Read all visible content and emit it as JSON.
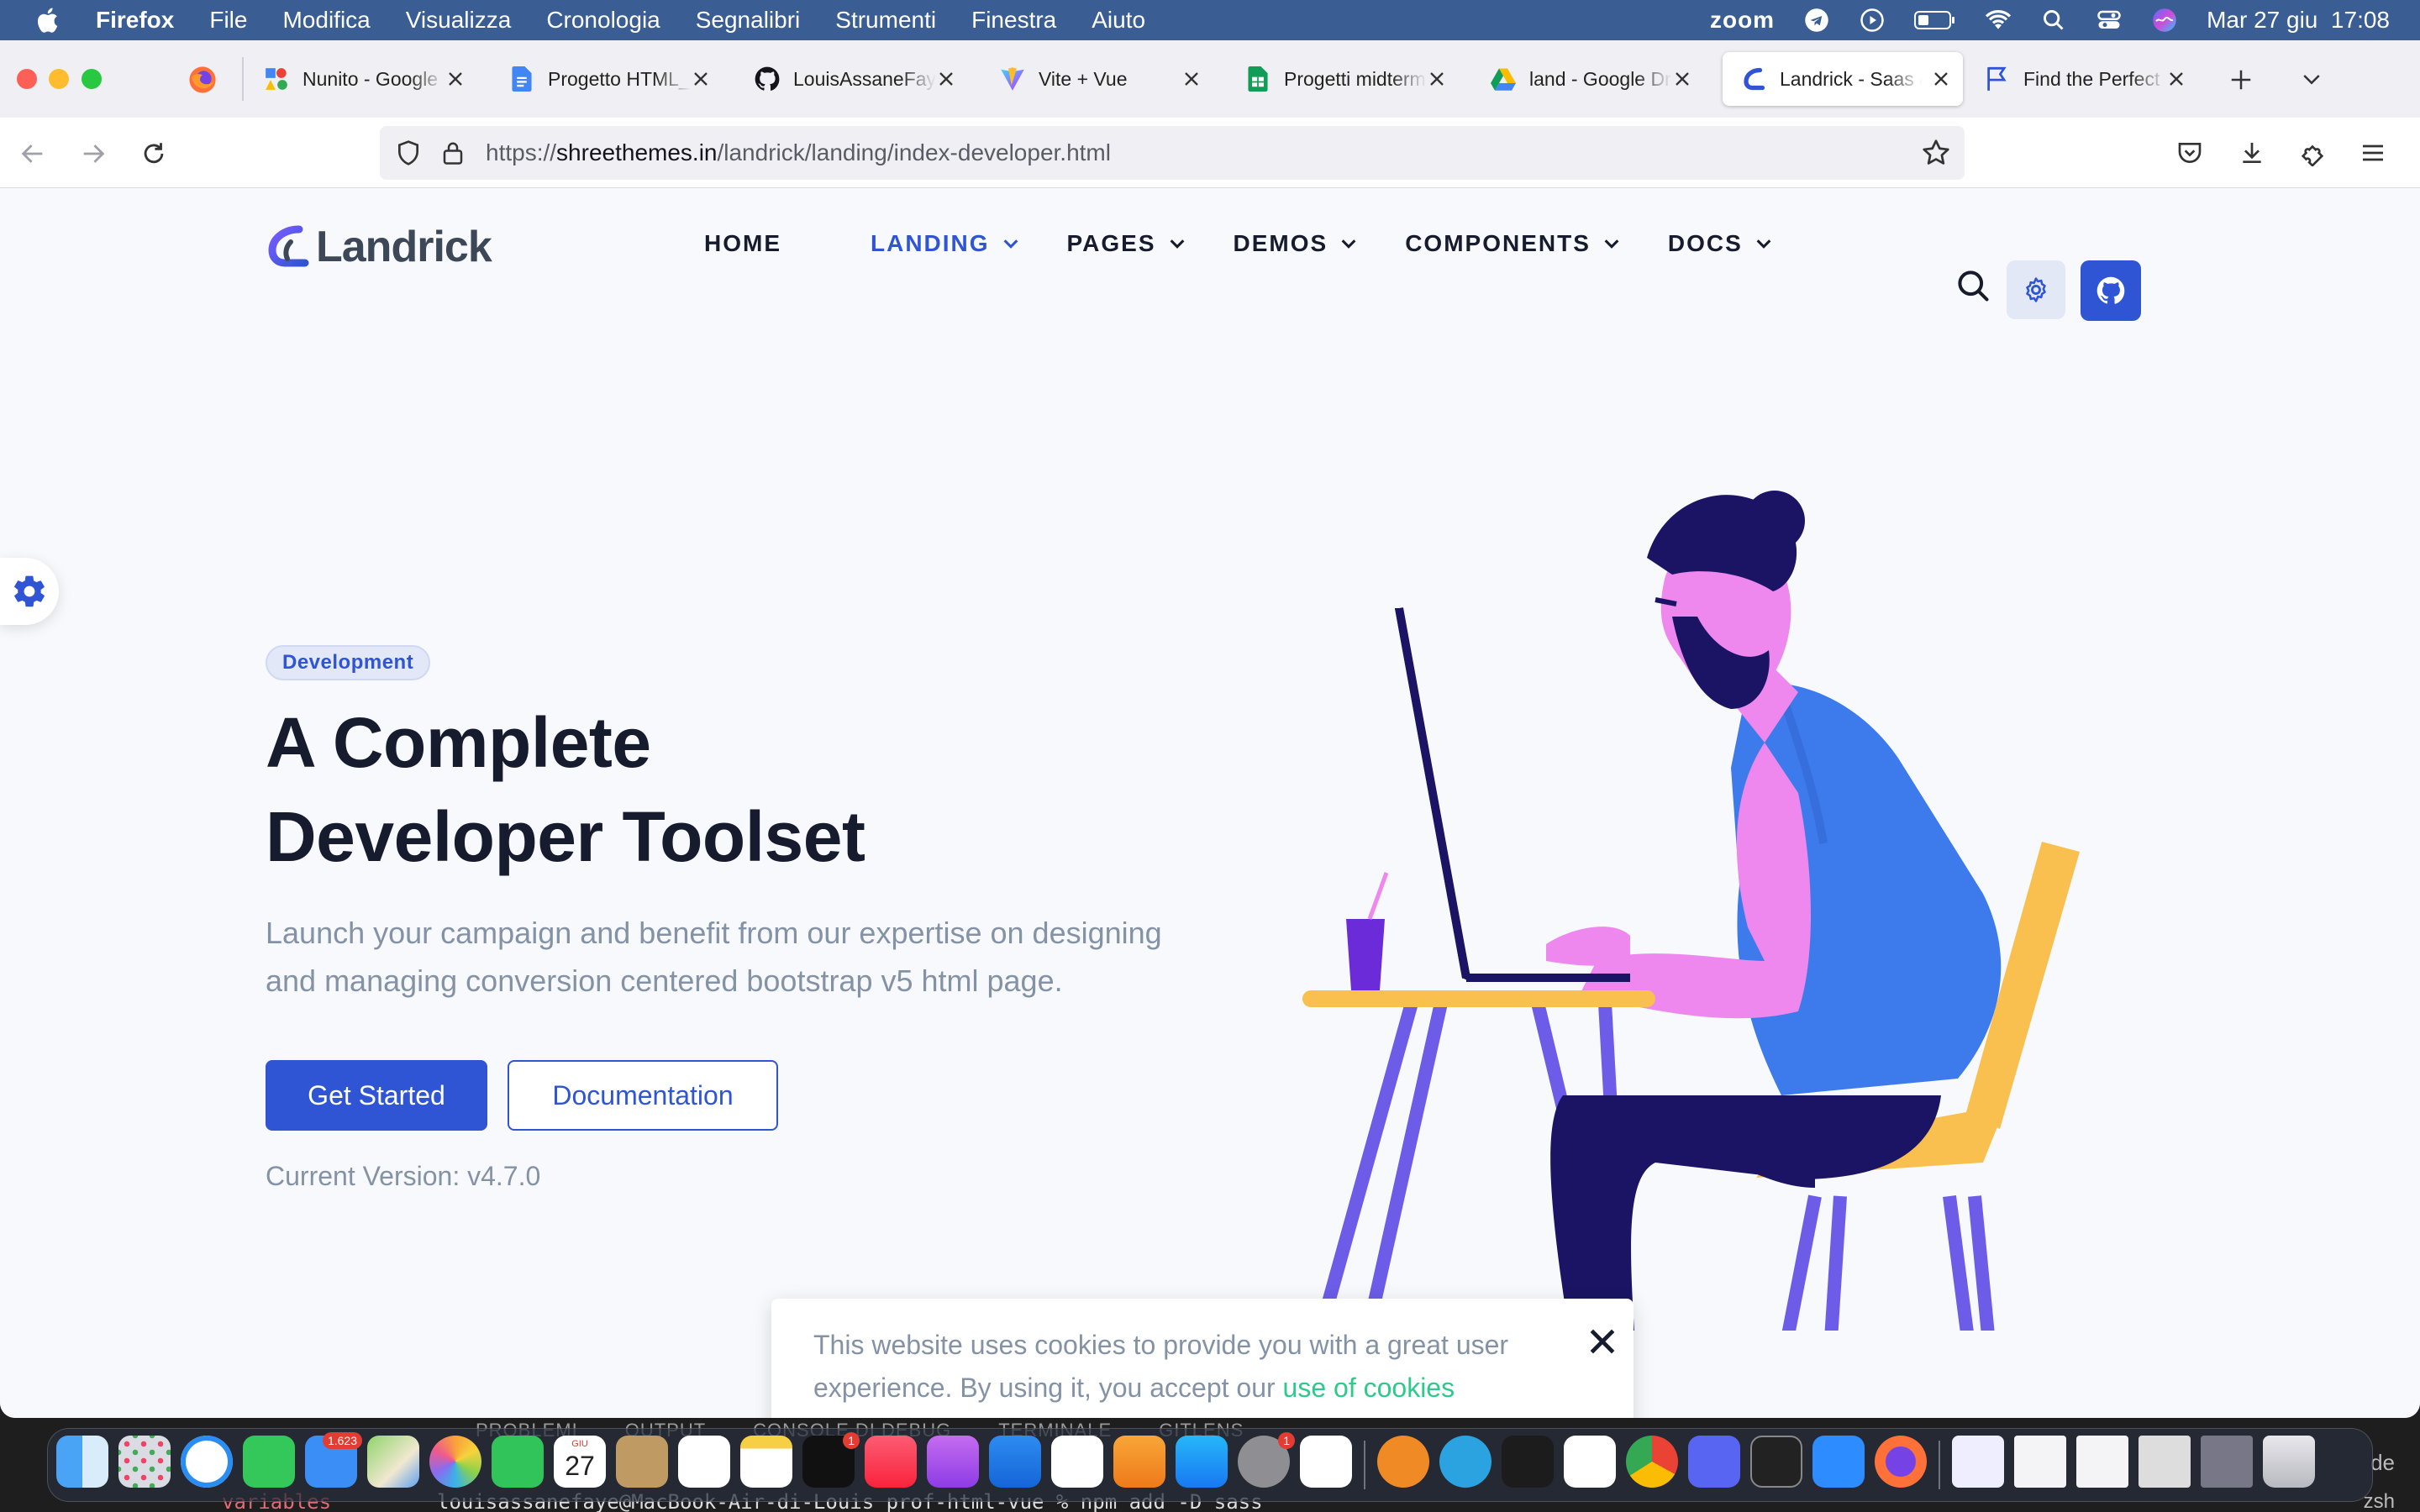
{
  "menubar": {
    "items": [
      "Firefox",
      "File",
      "Modifica",
      "Visualizza",
      "Cronologia",
      "Segnalibri",
      "Strumenti",
      "Finestra",
      "Aiuto"
    ],
    "zoom_label": "zoom",
    "clock": "Mar 27 giu  17:08"
  },
  "tabs": [
    {
      "title": "Nunito - Google F",
      "icon": "google-fonts-icon"
    },
    {
      "title": "Progetto HTML_V",
      "icon": "google-docs-icon"
    },
    {
      "title": "LouisAssaneFaye",
      "icon": "github-icon"
    },
    {
      "title": "Vite + Vue",
      "icon": "vite-icon"
    },
    {
      "title": "Progetti midterm",
      "icon": "google-sheets-icon"
    },
    {
      "title": "land - Google Dri",
      "icon": "google-drive-icon"
    },
    {
      "title": "Landrick - Saas &",
      "icon": "landrick-icon",
      "active": true
    },
    {
      "title": "Find the Perfect",
      "icon": "flag-icon"
    }
  ],
  "address": {
    "scheme": "https://",
    "host": "shreethemes.in",
    "path": "/landrick/landing/index-developer.html"
  },
  "site": {
    "logo_text": "Landrick",
    "nav": [
      {
        "label": "HOME",
        "dropdown": false
      },
      {
        "label": "LANDING",
        "dropdown": true,
        "active": true
      },
      {
        "label": "PAGES",
        "dropdown": true
      },
      {
        "label": "DEMOS",
        "dropdown": true
      },
      {
        "label": "COMPONENTS",
        "dropdown": true
      },
      {
        "label": "DOCS",
        "dropdown": true
      }
    ],
    "accent": "#2f55d4"
  },
  "hero": {
    "badge": "Development",
    "title_line1": "A Complete",
    "title_line2": "Developer Toolset",
    "lead_line1": "Launch your campaign and benefit from our expertise on designing",
    "lead_line2": "and managing conversion centered bootstrap v5 html page.",
    "primary_button": "Get Started",
    "secondary_button": "Documentation",
    "version": "Current Version: v4.7.0"
  },
  "cookie": {
    "line1": "This website uses cookies to provide you with a great user",
    "line2_prefix": "experience. By using it, you accept our ",
    "link": "use of cookies"
  },
  "behind": {
    "terminal_tabs": [
      "PROBLEMI",
      "OUTPUT",
      "CONSOLE DI DEBUG",
      "TERMINALE",
      "GITLENS"
    ],
    "command": "louisassanefaye@MacBook-Air-di-Louis prof-html-vue % npm add -D sass",
    "variable_label": "variables",
    "shell": "zsh",
    "side_text": "de"
  },
  "dock": {
    "mail_badge": "1.623",
    "calendar_month": "GIU",
    "calendar_day": "27",
    "tv_badge": "1",
    "settings_badge": "1"
  }
}
